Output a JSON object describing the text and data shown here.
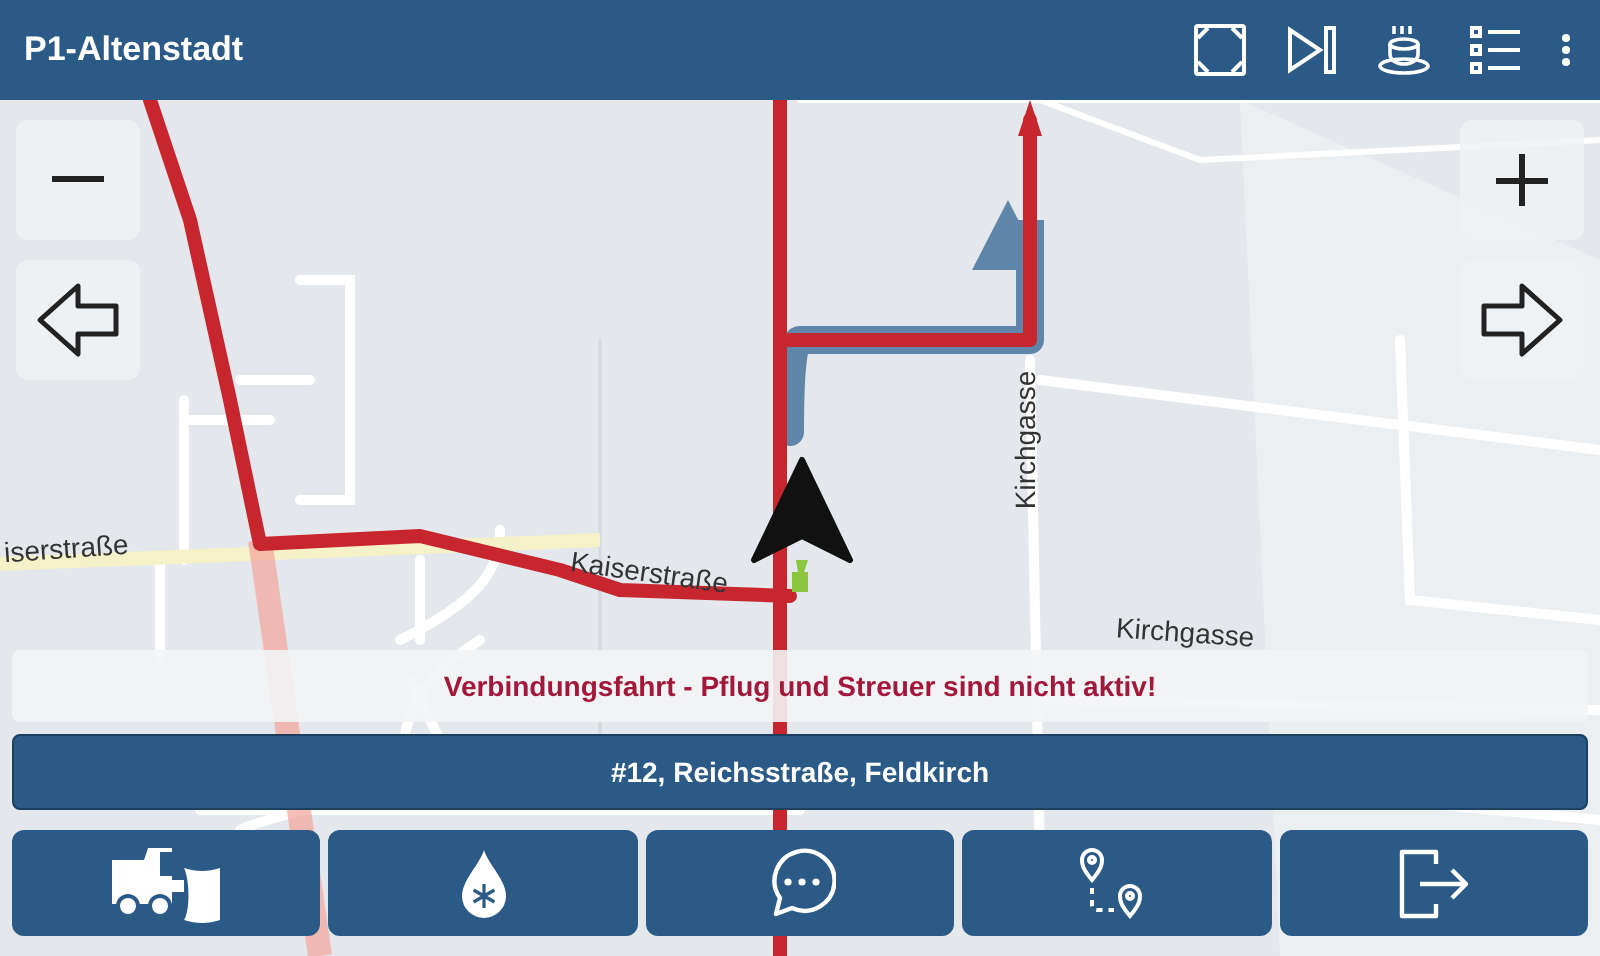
{
  "app_bar": {
    "title": "P1-Altenstadt"
  },
  "map": {
    "street_labels": [
      {
        "text": "iserstraße"
      },
      {
        "text": "Kaiserstraße"
      },
      {
        "text": "Kirchgasse"
      },
      {
        "text": "Kirchgasse"
      }
    ]
  },
  "notice": "Verbindungsfahrt - Pflug und Streuer sind nicht aktiv!",
  "address": "#12, Reichsstraße, Feldkirch"
}
